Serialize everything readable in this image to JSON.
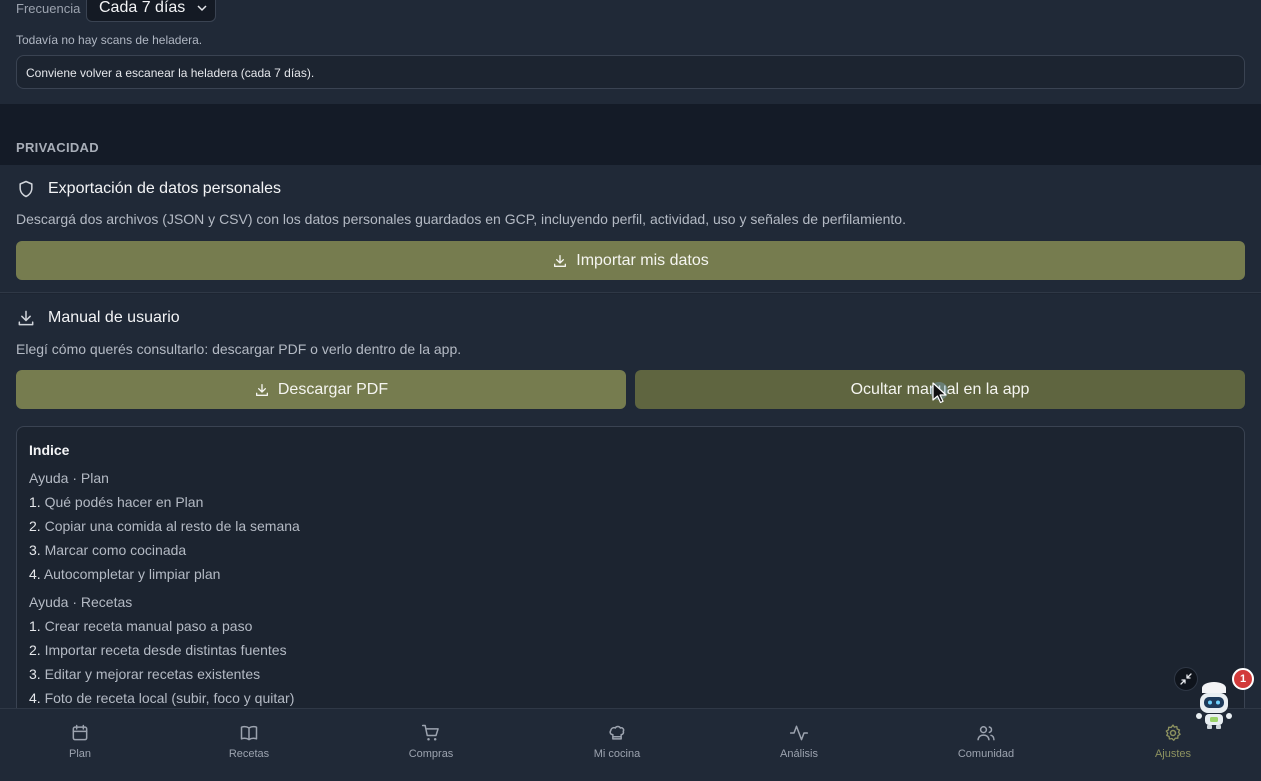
{
  "refrigerator": {
    "frequency_label": "Frecuencia",
    "frequency_value": "Cada 7 días",
    "no_scans_text": "Todavía no hay scans de heladera.",
    "hint_text": "Conviene volver a escanear la heladera (cada 7 días)."
  },
  "privacy": {
    "section_title": "PRIVACIDAD",
    "export": {
      "title": "Exportación de datos personales",
      "description": "Descargá dos archivos (JSON y CSV) con los datos personales guardados en GCP, incluyendo perfil, actividad, uso y señales de perfilamiento.",
      "button_label": "Importar mis datos"
    },
    "manual": {
      "title": "Manual de usuario",
      "description": "Elegí cómo querés consultarlo: descargar PDF o verlo dentro de la app.",
      "download_label": "Descargar PDF",
      "hide_label": "Ocultar manual en la app",
      "index": {
        "title": "Indice",
        "groups": [
          {
            "heading": "Ayuda · Plan",
            "items": [
              {
                "num": "1.",
                "text": "Qué podés hacer en Plan"
              },
              {
                "num": "2.",
                "text": "Copiar una comida al resto de la semana"
              },
              {
                "num": "3.",
                "text": "Marcar como cocinada"
              },
              {
                "num": "4.",
                "text": "Autocompletar y limpiar plan"
              }
            ]
          },
          {
            "heading": "Ayuda · Recetas",
            "items": [
              {
                "num": "1.",
                "text": "Crear receta manual paso a paso"
              },
              {
                "num": "2.",
                "text": "Importar receta desde distintas fuentes"
              },
              {
                "num": "3.",
                "text": "Editar y mejorar recetas existentes"
              },
              {
                "num": "4.",
                "text": "Foto de receta local (subir, foco y quitar)"
              }
            ]
          }
        ]
      }
    }
  },
  "nav": {
    "items": [
      {
        "label": "Plan",
        "icon": "calendar-icon"
      },
      {
        "label": "Recetas",
        "icon": "book-icon"
      },
      {
        "label": "Compras",
        "icon": "cart-icon"
      },
      {
        "label": "Mi cocina",
        "icon": "chef-hat-icon"
      },
      {
        "label": "Análisis",
        "icon": "activity-icon"
      },
      {
        "label": "Comunidad",
        "icon": "users-icon"
      },
      {
        "label": "Ajustes",
        "icon": "gear-icon"
      }
    ],
    "active": "Ajustes"
  },
  "assistant": {
    "badge_count": "1"
  },
  "colors": {
    "accent_button": "#767c4f",
    "active_nav": "#8d9260",
    "badge": "#d23a3a"
  }
}
